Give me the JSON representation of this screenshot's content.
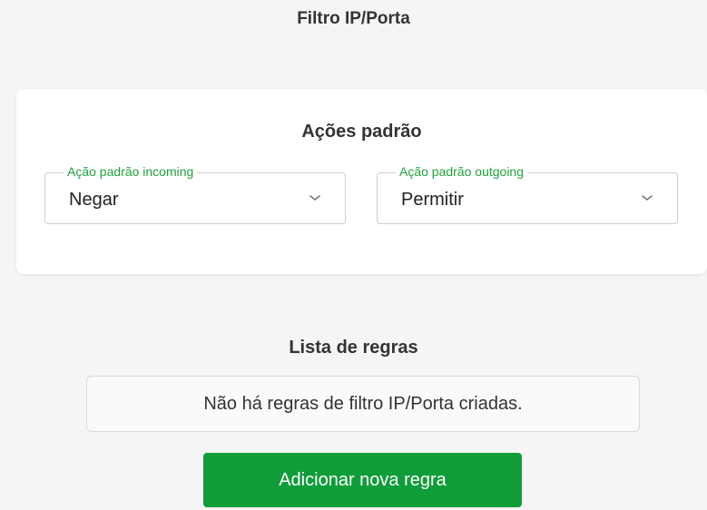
{
  "page": {
    "title": "Filtro IP/Porta"
  },
  "default_actions": {
    "title": "Ações padrão",
    "incoming": {
      "label": "Ação padrão incoming",
      "value": "Negar",
      "icon": "chevron-down-icon"
    },
    "outgoing": {
      "label": "Ação padrão outgoing",
      "value": "Permitir",
      "icon": "chevron-down-icon"
    }
  },
  "rules": {
    "title": "Lista de regras",
    "empty_message": "Não há regras de filtro IP/Porta criadas.",
    "add_button_label": "Adicionar nova regra"
  },
  "colors": {
    "accent_green": "#0f9d3a",
    "legend_green": "#1fa33c",
    "background": "#f5f5f5"
  }
}
